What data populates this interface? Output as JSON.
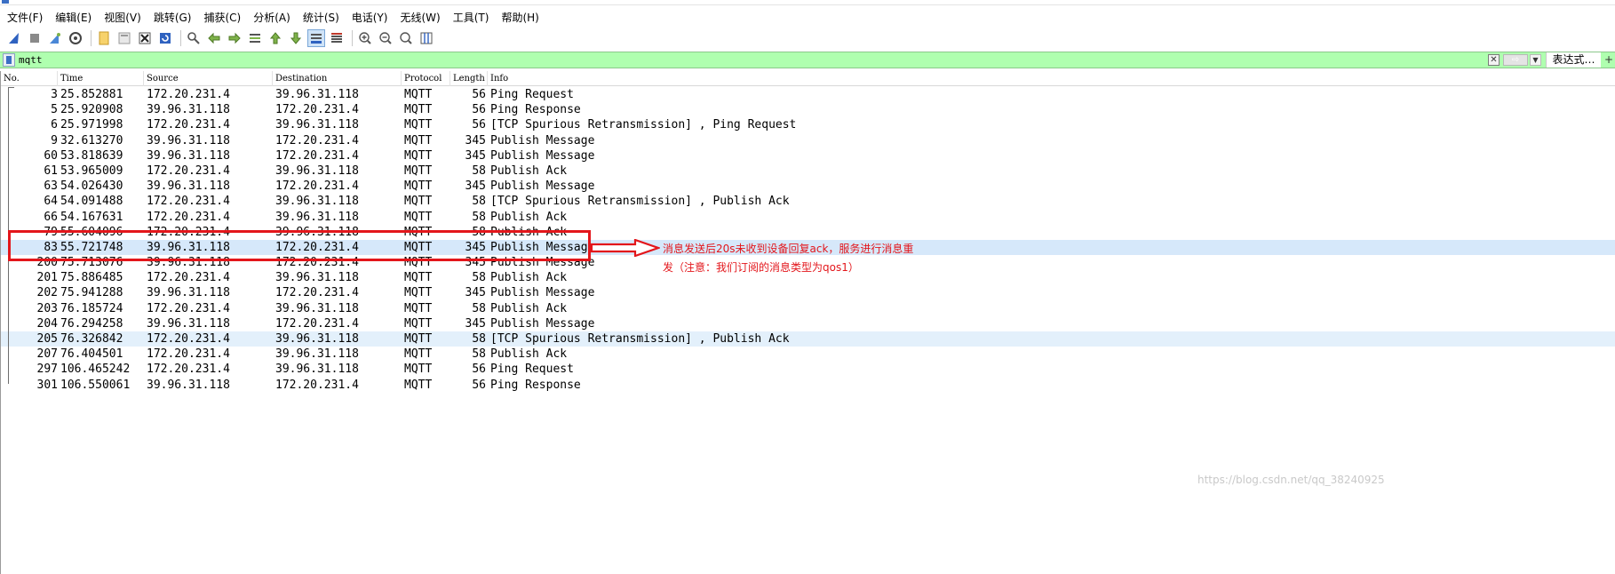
{
  "menu": [
    "文件(F)",
    "编辑(E)",
    "视图(V)",
    "跳转(G)",
    "捕获(C)",
    "分析(A)",
    "统计(S)",
    "电话(Y)",
    "无线(W)",
    "工具(T)",
    "帮助(H)"
  ],
  "filter": {
    "value": "mqtt",
    "expression_label": "表达式…",
    "plus_label": "+"
  },
  "columns": {
    "no": "No.",
    "time": "Time",
    "source": "Source",
    "destination": "Destination",
    "protocol": "Protocol",
    "length": "Length",
    "info": "Info"
  },
  "packets": [
    {
      "no": "3",
      "time": "25.852881",
      "source": "172.20.231.4",
      "destination": "39.96.31.118",
      "protocol": "MQTT",
      "length": "56",
      "info": "Ping Request"
    },
    {
      "no": "5",
      "time": "25.920908",
      "source": "39.96.31.118",
      "destination": "172.20.231.4",
      "protocol": "MQTT",
      "length": "56",
      "info": "Ping Response"
    },
    {
      "no": "6",
      "time": "25.971998",
      "source": "172.20.231.4",
      "destination": "39.96.31.118",
      "protocol": "MQTT",
      "length": "56",
      "info": "[TCP Spurious Retransmission] , Ping Request"
    },
    {
      "no": "9",
      "time": "32.613270",
      "source": "39.96.31.118",
      "destination": "172.20.231.4",
      "protocol": "MQTT",
      "length": "345",
      "info": "Publish Message"
    },
    {
      "no": "60",
      "time": "53.818639",
      "source": "39.96.31.118",
      "destination": "172.20.231.4",
      "protocol": "MQTT",
      "length": "345",
      "info": "Publish Message"
    },
    {
      "no": "61",
      "time": "53.965009",
      "source": "172.20.231.4",
      "destination": "39.96.31.118",
      "protocol": "MQTT",
      "length": "58",
      "info": "Publish Ack"
    },
    {
      "no": "63",
      "time": "54.026430",
      "source": "39.96.31.118",
      "destination": "172.20.231.4",
      "protocol": "MQTT",
      "length": "345",
      "info": "Publish Message"
    },
    {
      "no": "64",
      "time": "54.091488",
      "source": "172.20.231.4",
      "destination": "39.96.31.118",
      "protocol": "MQTT",
      "length": "58",
      "info": "[TCP Spurious Retransmission] , Publish Ack"
    },
    {
      "no": "66",
      "time": "54.167631",
      "source": "172.20.231.4",
      "destination": "39.96.31.118",
      "protocol": "MQTT",
      "length": "58",
      "info": "Publish Ack"
    },
    {
      "no": "79",
      "time": "55.604096",
      "source": "172.20.231.4",
      "destination": "39.96.31.118",
      "protocol": "MQTT",
      "length": "58",
      "info": "Publish Ack"
    },
    {
      "no": "83",
      "time": "55.721748",
      "source": "39.96.31.118",
      "destination": "172.20.231.4",
      "protocol": "MQTT",
      "length": "345",
      "info": "Publish Message",
      "row_style": "selected"
    },
    {
      "no": "200",
      "time": "75.713076",
      "source": "39.96.31.118",
      "destination": "172.20.231.4",
      "protocol": "MQTT",
      "length": "345",
      "info": "Publish Message"
    },
    {
      "no": "201",
      "time": "75.886485",
      "source": "172.20.231.4",
      "destination": "39.96.31.118",
      "protocol": "MQTT",
      "length": "58",
      "info": "Publish Ack"
    },
    {
      "no": "202",
      "time": "75.941288",
      "source": "39.96.31.118",
      "destination": "172.20.231.4",
      "protocol": "MQTT",
      "length": "345",
      "info": "Publish Message"
    },
    {
      "no": "203",
      "time": "76.185724",
      "source": "172.20.231.4",
      "destination": "39.96.31.118",
      "protocol": "MQTT",
      "length": "58",
      "info": "Publish Ack"
    },
    {
      "no": "204",
      "time": "76.294258",
      "source": "39.96.31.118",
      "destination": "172.20.231.4",
      "protocol": "MQTT",
      "length": "345",
      "info": "Publish Message"
    },
    {
      "no": "205",
      "time": "76.326842",
      "source": "172.20.231.4",
      "destination": "39.96.31.118",
      "protocol": "MQTT",
      "length": "58",
      "info": "[TCP Spurious Retransmission] , Publish Ack",
      "row_style": "related"
    },
    {
      "no": "207",
      "time": "76.404501",
      "source": "172.20.231.4",
      "destination": "39.96.31.118",
      "protocol": "MQTT",
      "length": "58",
      "info": "Publish Ack"
    },
    {
      "no": "297",
      "time": "106.465242",
      "source": "172.20.231.4",
      "destination": "39.96.31.118",
      "protocol": "MQTT",
      "length": "56",
      "info": "Ping Request"
    },
    {
      "no": "301",
      "time": "106.550061",
      "source": "39.96.31.118",
      "destination": "172.20.231.4",
      "protocol": "MQTT",
      "length": "56",
      "info": "Ping Response"
    }
  ],
  "annotation": {
    "text": "消息发送后20s未收到设备回复ack，服务进行消息重发（注意：我们订阅的消息类型为qos1）",
    "color": "#e3161b"
  },
  "watermark": "https://blog.csdn.net/qq_38240925",
  "colors": {
    "filter_valid_bg": "#afffaf",
    "selected_row_bg": "#d6e8fa",
    "related_row_bg": "#e3f0fb"
  }
}
